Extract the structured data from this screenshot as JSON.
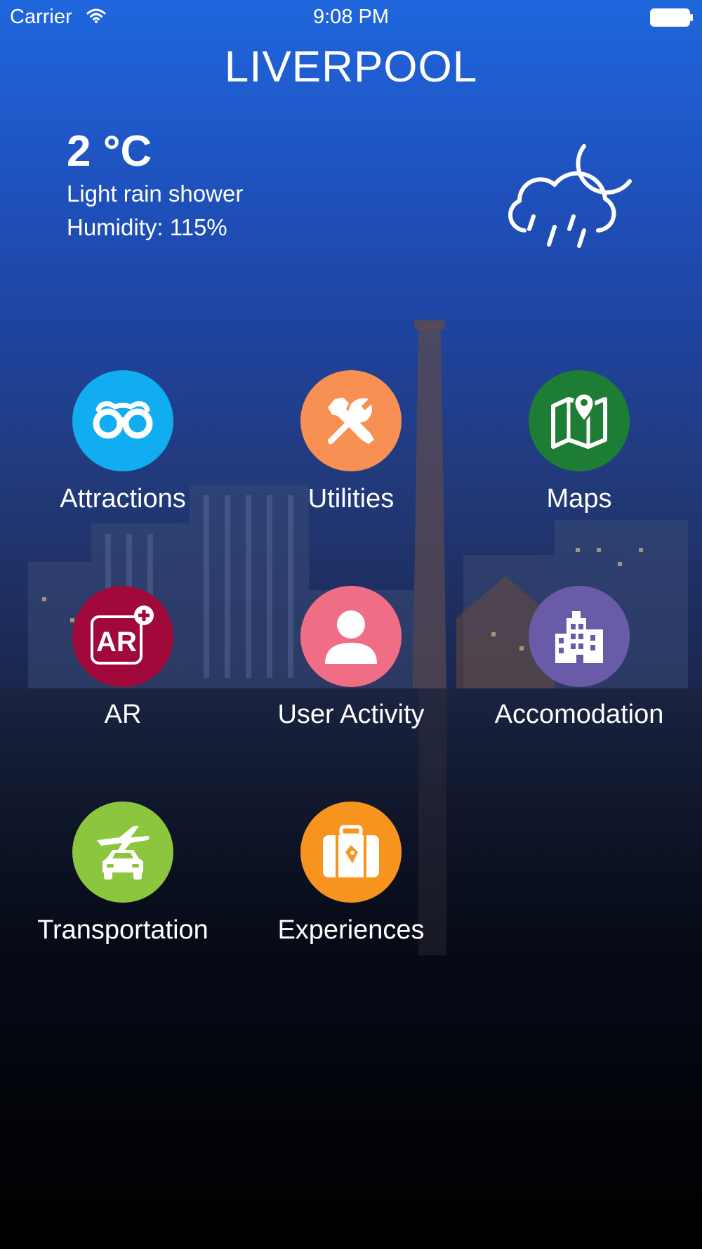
{
  "status_bar": {
    "carrier": "Carrier",
    "time": "9:08 PM"
  },
  "header": {
    "city": "LIVERPOOL"
  },
  "weather": {
    "temperature": "2 °C",
    "condition": "Light rain shower",
    "humidity": "Humidity: 115%",
    "icon": "cloud-rain-moon-icon"
  },
  "menu": [
    {
      "label": "Attractions",
      "icon": "binoculars-icon",
      "color": "#10aef0"
    },
    {
      "label": "Utilities",
      "icon": "tools-icon",
      "color": "#f79052"
    },
    {
      "label": "Maps",
      "icon": "map-pin-icon",
      "color": "#1e7d35"
    },
    {
      "label": "AR",
      "icon": "ar-plus-icon",
      "color": "#a0093a"
    },
    {
      "label": "User Activity",
      "icon": "user-icon",
      "color": "#f06e85"
    },
    {
      "label": "Accomodation",
      "icon": "building-icon",
      "color": "#6a5ba8"
    },
    {
      "label": "Transportation",
      "icon": "plane-car-icon",
      "color": "#8cc63e"
    },
    {
      "label": "Experiences",
      "icon": "suitcase-icon",
      "color": "#f7941d"
    }
  ]
}
